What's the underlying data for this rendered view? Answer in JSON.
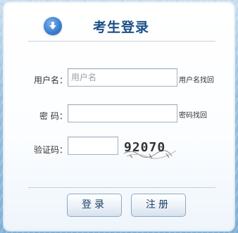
{
  "title": "考生登录",
  "form": {
    "username_label": "用户名：",
    "username_placeholder": "用户名",
    "username_recover_link": "用户名找回",
    "password_label": "密 码：",
    "password_recover_link": "密码找回",
    "captcha_label": "验证码：",
    "captcha_text": "92070"
  },
  "buttons": {
    "login": "登录",
    "register": "注册"
  },
  "colors": {
    "title": "#1a4f86",
    "icon": "#3b82d4"
  },
  "icons": {
    "title_icon": "down-arrow-circle-icon"
  }
}
